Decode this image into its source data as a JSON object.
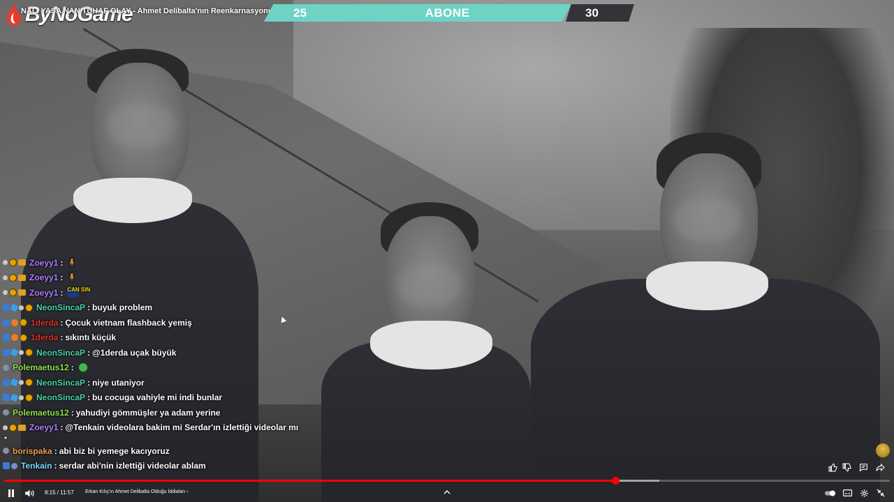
{
  "header": {
    "logo_text": "ByNoGame",
    "video_title": "NALI YASA NAN TUHAF OLAY - Ahmet Delibalta'nın Reenkarnasyonu"
  },
  "subscriber_goal": {
    "current": "25",
    "label": "ABONE",
    "goal": "30",
    "progress": 0.83,
    "colors": {
      "fill": "#6ed3c4",
      "rest": "#333438"
    }
  },
  "chat": {
    "messages": [
      {
        "user": "Zoeyy1",
        "color": "#b27cff",
        "badges": [
          "dot",
          "gold",
          "card"
        ],
        "text": "",
        "emote": "man-emote"
      },
      {
        "user": "Zoeyy1",
        "color": "#b27cff",
        "badges": [
          "dot",
          "gold",
          "card"
        ],
        "text": "",
        "emote": "man-emote"
      },
      {
        "user": "Zoeyy1",
        "color": "#b27cff",
        "badges": [
          "dot",
          "gold",
          "card"
        ],
        "text": "",
        "emote": "can-sin-emote",
        "emote_text": "CAN SIN"
      },
      {
        "user": "NeonSincaP",
        "color": "#49d3a0",
        "badges": [
          "sq",
          "cube",
          "dot",
          "gold"
        ],
        "text": "buyuk problem"
      },
      {
        "user": "1derda",
        "color": "#e0302a",
        "badges": [
          "sq",
          "orange",
          "gold"
        ],
        "text": "Çocuk vietnam flashback yemiş"
      },
      {
        "user": "1derda",
        "color": "#e0302a",
        "badges": [
          "sq",
          "orange",
          "gold"
        ],
        "text": "sıkıntı küçük"
      },
      {
        "user": "NeonSincaP",
        "color": "#49d3a0",
        "badges": [
          "sq",
          "cube",
          "dot",
          "gold"
        ],
        "text": "@1derda uçak büyük"
      },
      {
        "user": "Polemaetus12",
        "color": "#8fe04a",
        "badges": [
          "grey"
        ],
        "text": "",
        "emote": "green-emote"
      },
      {
        "user": "NeonSincaP",
        "color": "#49d3a0",
        "badges": [
          "sq",
          "cube",
          "dot",
          "gold"
        ],
        "text": "niye utaniyor"
      },
      {
        "user": "NeonSincaP",
        "color": "#49d3a0",
        "badges": [
          "sq",
          "cube",
          "dot",
          "gold"
        ],
        "text": "bu cocuga vahiyle mi indi bunlar"
      },
      {
        "user": "Polemaetus12",
        "color": "#8fe04a",
        "badges": [
          "grey"
        ],
        "text": "yahudiyi gömmüşler ya adam yerine"
      },
      {
        "user": "Zoeyy1",
        "color": "#b27cff",
        "badges": [
          "dot",
          "gold",
          "card"
        ],
        "text": "@Tenkain videolara bakim mi Serdar'ın izlettiği videolar mı"
      },
      {
        "user": "",
        "color": "#ffffff",
        "badges": [],
        "text": "*",
        "star": true
      },
      {
        "user": "borispaka",
        "color": "#e8a050",
        "badges": [
          "grey"
        ],
        "text": "abi biz bi yemege kacıyoruz"
      },
      {
        "user": "Tenkain",
        "color": "#7fd6ff",
        "badges": [
          "sq",
          "blue2"
        ],
        "text": "serdar abi'nin izlettiği videolar ablam"
      }
    ]
  },
  "player": {
    "time": "8:15 / 11:57",
    "chapter": "Erkan Kılıç'ın Ahmet Delibalta Olduğu İddiaları",
    "played_fraction": 0.69,
    "buffered_fraction": 0.74,
    "colors": {
      "played": "#ff0000"
    }
  }
}
